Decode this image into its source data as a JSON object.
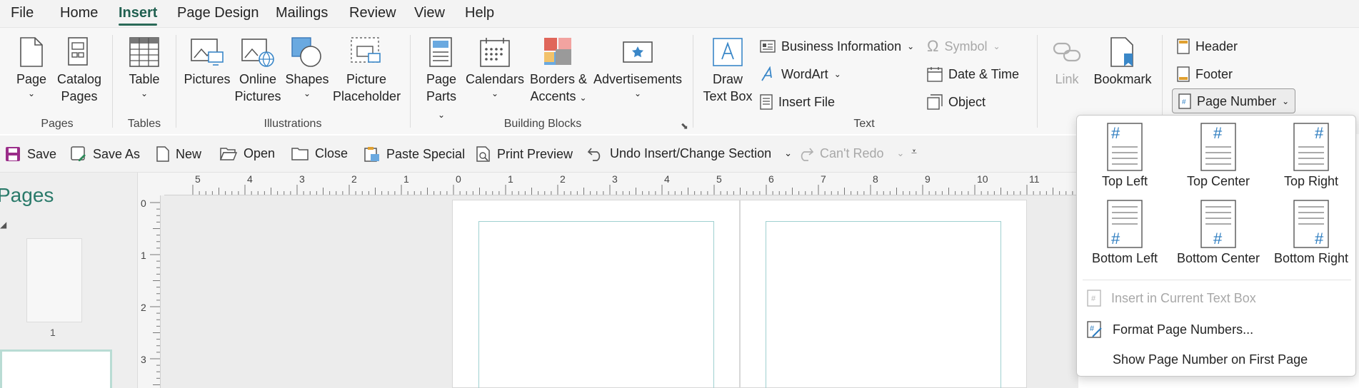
{
  "menu": {
    "tabs": [
      "File",
      "Home",
      "Insert",
      "Page Design",
      "Mailings",
      "Review",
      "View",
      "Help"
    ],
    "active": "Insert"
  },
  "ribbon": {
    "pages_group": {
      "label": "Pages",
      "page": "Page",
      "catalog_line1": "Catalog",
      "catalog_line2": "Pages"
    },
    "tables_group": {
      "label": "Tables",
      "table": "Table"
    },
    "illustrations_group": {
      "label": "Illustrations",
      "pictures": "Pictures",
      "online_line1": "Online",
      "online_line2": "Pictures",
      "shapes": "Shapes",
      "placeholder_line1": "Picture",
      "placeholder_line2": "Placeholder"
    },
    "building_blocks_group": {
      "label": "Building Blocks",
      "page_parts_line1": "Page",
      "page_parts_line2": "Parts",
      "calendars": "Calendars",
      "borders_line1": "Borders &",
      "borders_line2": "Accents",
      "advertisements": "Advertisements"
    },
    "text_group": {
      "label": "Text",
      "draw_line1": "Draw",
      "draw_line2": "Text Box",
      "business_info": "Business Information",
      "wordart": "WordArt",
      "insert_file": "Insert File",
      "symbol": "Symbol",
      "date_time": "Date & Time",
      "object": "Object"
    },
    "links_group": {
      "link": "Link",
      "bookmark": "Bookmark"
    },
    "header_footer_group": {
      "header": "Header",
      "footer": "Footer",
      "page_number": "Page Number"
    }
  },
  "quick_access": {
    "save": "Save",
    "save_as": "Save As",
    "new": "New",
    "open": "Open",
    "close": "Close",
    "paste_special": "Paste Special",
    "print_preview": "Print Preview",
    "undo": "Undo Insert/Change Section",
    "redo": "Can't Redo"
  },
  "pages_panel": {
    "title": "Pages",
    "thumb_number": "1"
  },
  "ruler": {
    "h_labels": [
      "5",
      "4",
      "3",
      "2",
      "1",
      "0",
      "1",
      "2",
      "3",
      "4",
      "5",
      "6",
      "7",
      "8",
      "9",
      "10",
      "11"
    ],
    "v_labels": [
      "0",
      "1",
      "2",
      "3"
    ]
  },
  "page_number_menu": {
    "top_left": "Top Left",
    "top_center": "Top Center",
    "top_right": "Top Right",
    "bottom_left": "Bottom Left",
    "bottom_center": "Bottom Center",
    "bottom_right": "Bottom Right",
    "hash": "#",
    "insert_current": "Insert in Current Text Box",
    "format": "Format Page Numbers...",
    "show_first": "Show Page Number on First Page"
  },
  "colors": {
    "accent": "#2a6a58",
    "pn_hash": "#2b7bbf",
    "disabled": "#a8a8a8"
  }
}
